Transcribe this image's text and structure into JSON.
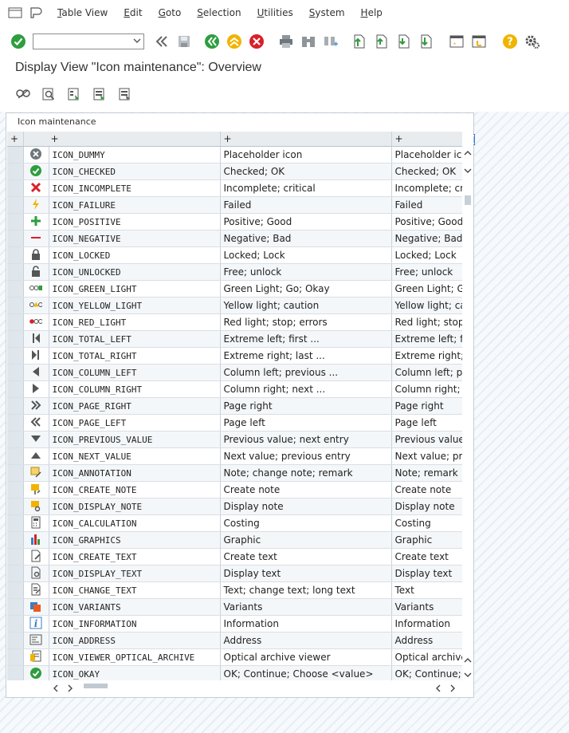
{
  "menubar": {
    "items": [
      {
        "label": "Table View",
        "ul": "T",
        "rest": "able View"
      },
      {
        "label": "Edit",
        "ul": "E",
        "rest": "dit"
      },
      {
        "label": "Goto",
        "ul": "G",
        "rest": "oto"
      },
      {
        "label": "Selection",
        "ul": "S",
        "rest": "election"
      },
      {
        "label": "Utilities",
        "ul": "U",
        "rest": "tilities"
      },
      {
        "label": "System",
        "ul": "S",
        "rest": "ystem"
      },
      {
        "label": "Help",
        "ul": "H",
        "rest": "elp"
      }
    ]
  },
  "toolbar": {
    "command_value": "",
    "accent_green": "#2e9e3e",
    "accent_yellow": "#f0b400",
    "accent_red": "#d9202a"
  },
  "page": {
    "title": "Display View \"Icon maintenance\": Overview"
  },
  "table": {
    "caption": "Icon maintenance",
    "headers": [
      "+",
      "+",
      "+",
      "+"
    ],
    "rows": [
      {
        "icon": "dummy-icon",
        "name": "ICON_DUMMY",
        "text": "Placeholder icon",
        "text2": "Placeholder icon"
      },
      {
        "icon": "checked-icon",
        "name": "ICON_CHECKED",
        "text": "Checked; OK",
        "text2": "Checked; OK"
      },
      {
        "icon": "incomplete-icon",
        "name": "ICON_INCOMPLETE",
        "text": "Incomplete; critical",
        "text2": "Incomplete; critical"
      },
      {
        "icon": "failure-icon",
        "name": "ICON_FAILURE",
        "text": "Failed",
        "text2": "Failed"
      },
      {
        "icon": "positive-icon",
        "name": "ICON_POSITIVE",
        "text": "Positive; Good",
        "text2": "Positive; Good"
      },
      {
        "icon": "negative-icon",
        "name": "ICON_NEGATIVE",
        "text": "Negative; Bad",
        "text2": "Negative; Bad"
      },
      {
        "icon": "locked-icon",
        "name": "ICON_LOCKED",
        "text": "Locked; Lock",
        "text2": "Locked; Lock"
      },
      {
        "icon": "unlocked-icon",
        "name": "ICON_UNLOCKED",
        "text": "Free; unlock",
        "text2": "Free; unlock"
      },
      {
        "icon": "green-light-icon",
        "name": "ICON_GREEN_LIGHT",
        "text": "Green Light; Go; Okay",
        "text2": "Green Light; Go; Okay"
      },
      {
        "icon": "yellow-light-icon",
        "name": "ICON_YELLOW_LIGHT",
        "text": "Yellow light; caution",
        "text2": "Yellow light; caution"
      },
      {
        "icon": "red-light-icon",
        "name": "ICON_RED_LIGHT",
        "text": "Red light; stop; errors",
        "text2": "Red light; stop; errors"
      },
      {
        "icon": "total-left-icon",
        "name": "ICON_TOTAL_LEFT",
        "text": "Extreme left; first ...",
        "text2": "Extreme left; first ..."
      },
      {
        "icon": "total-right-icon",
        "name": "ICON_TOTAL_RIGHT",
        "text": "Extreme right; last ...",
        "text2": "Extreme right; last ..."
      },
      {
        "icon": "column-left-icon",
        "name": "ICON_COLUMN_LEFT",
        "text": "Column left; previous ...",
        "text2": "Column left; previous ..."
      },
      {
        "icon": "column-right-icon",
        "name": "ICON_COLUMN_RIGHT",
        "text": "Column right; next ...",
        "text2": "Column right; next ..."
      },
      {
        "icon": "page-right-icon",
        "name": "ICON_PAGE_RIGHT",
        "text": "Page right",
        "text2": "Page right"
      },
      {
        "icon": "page-left-icon",
        "name": "ICON_PAGE_LEFT",
        "text": "Page left",
        "text2": "Page left"
      },
      {
        "icon": "previous-value-icon",
        "name": "ICON_PREVIOUS_VALUE",
        "text": "Previous value; next entry",
        "text2": "Previous value; next entry"
      },
      {
        "icon": "next-value-icon",
        "name": "ICON_NEXT_VALUE",
        "text": "Next value; previous entry",
        "text2": "Next value; previous entry"
      },
      {
        "icon": "annotation-icon",
        "name": "ICON_ANNOTATION",
        "text": "Note; change note; remark",
        "text2": "Note; remark"
      },
      {
        "icon": "create-note-icon",
        "name": "ICON_CREATE_NOTE",
        "text": "Create note",
        "text2": "Create note"
      },
      {
        "icon": "display-note-icon",
        "name": "ICON_DISPLAY_NOTE",
        "text": "Display note",
        "text2": "Display note"
      },
      {
        "icon": "calculation-icon",
        "name": "ICON_CALCULATION",
        "text": "Costing",
        "text2": "Costing"
      },
      {
        "icon": "graphics-icon",
        "name": "ICON_GRAPHICS",
        "text": "Graphic",
        "text2": "Graphic"
      },
      {
        "icon": "create-text-icon",
        "name": "ICON_CREATE_TEXT",
        "text": "Create text",
        "text2": "Create text"
      },
      {
        "icon": "display-text-icon",
        "name": "ICON_DISPLAY_TEXT",
        "text": "Display text",
        "text2": "Display text"
      },
      {
        "icon": "change-text-icon",
        "name": "ICON_CHANGE_TEXT",
        "text": "Text; change text; long text",
        "text2": "Text"
      },
      {
        "icon": "variants-icon",
        "name": "ICON_VARIANTS",
        "text": "Variants",
        "text2": "Variants"
      },
      {
        "icon": "information-icon",
        "name": "ICON_INFORMATION",
        "text": "Information",
        "text2": "Information"
      },
      {
        "icon": "address-icon",
        "name": "ICON_ADDRESS",
        "text": "Address",
        "text2": "Address"
      },
      {
        "icon": "viewer-optical-archive-icon",
        "name": "ICON_VIEWER_OPTICAL_ARCHIVE",
        "text": "Optical archive viewer",
        "text2": "Optical archive viewer"
      },
      {
        "icon": "okay-icon",
        "name": "ICON_OKAY",
        "text": "OK; Continue; Choose <value>",
        "text2": "OK; Continue; Choose <value>"
      }
    ]
  },
  "scroll": {
    "left": "<",
    "right": ">",
    "up": "^",
    "down": "v"
  }
}
